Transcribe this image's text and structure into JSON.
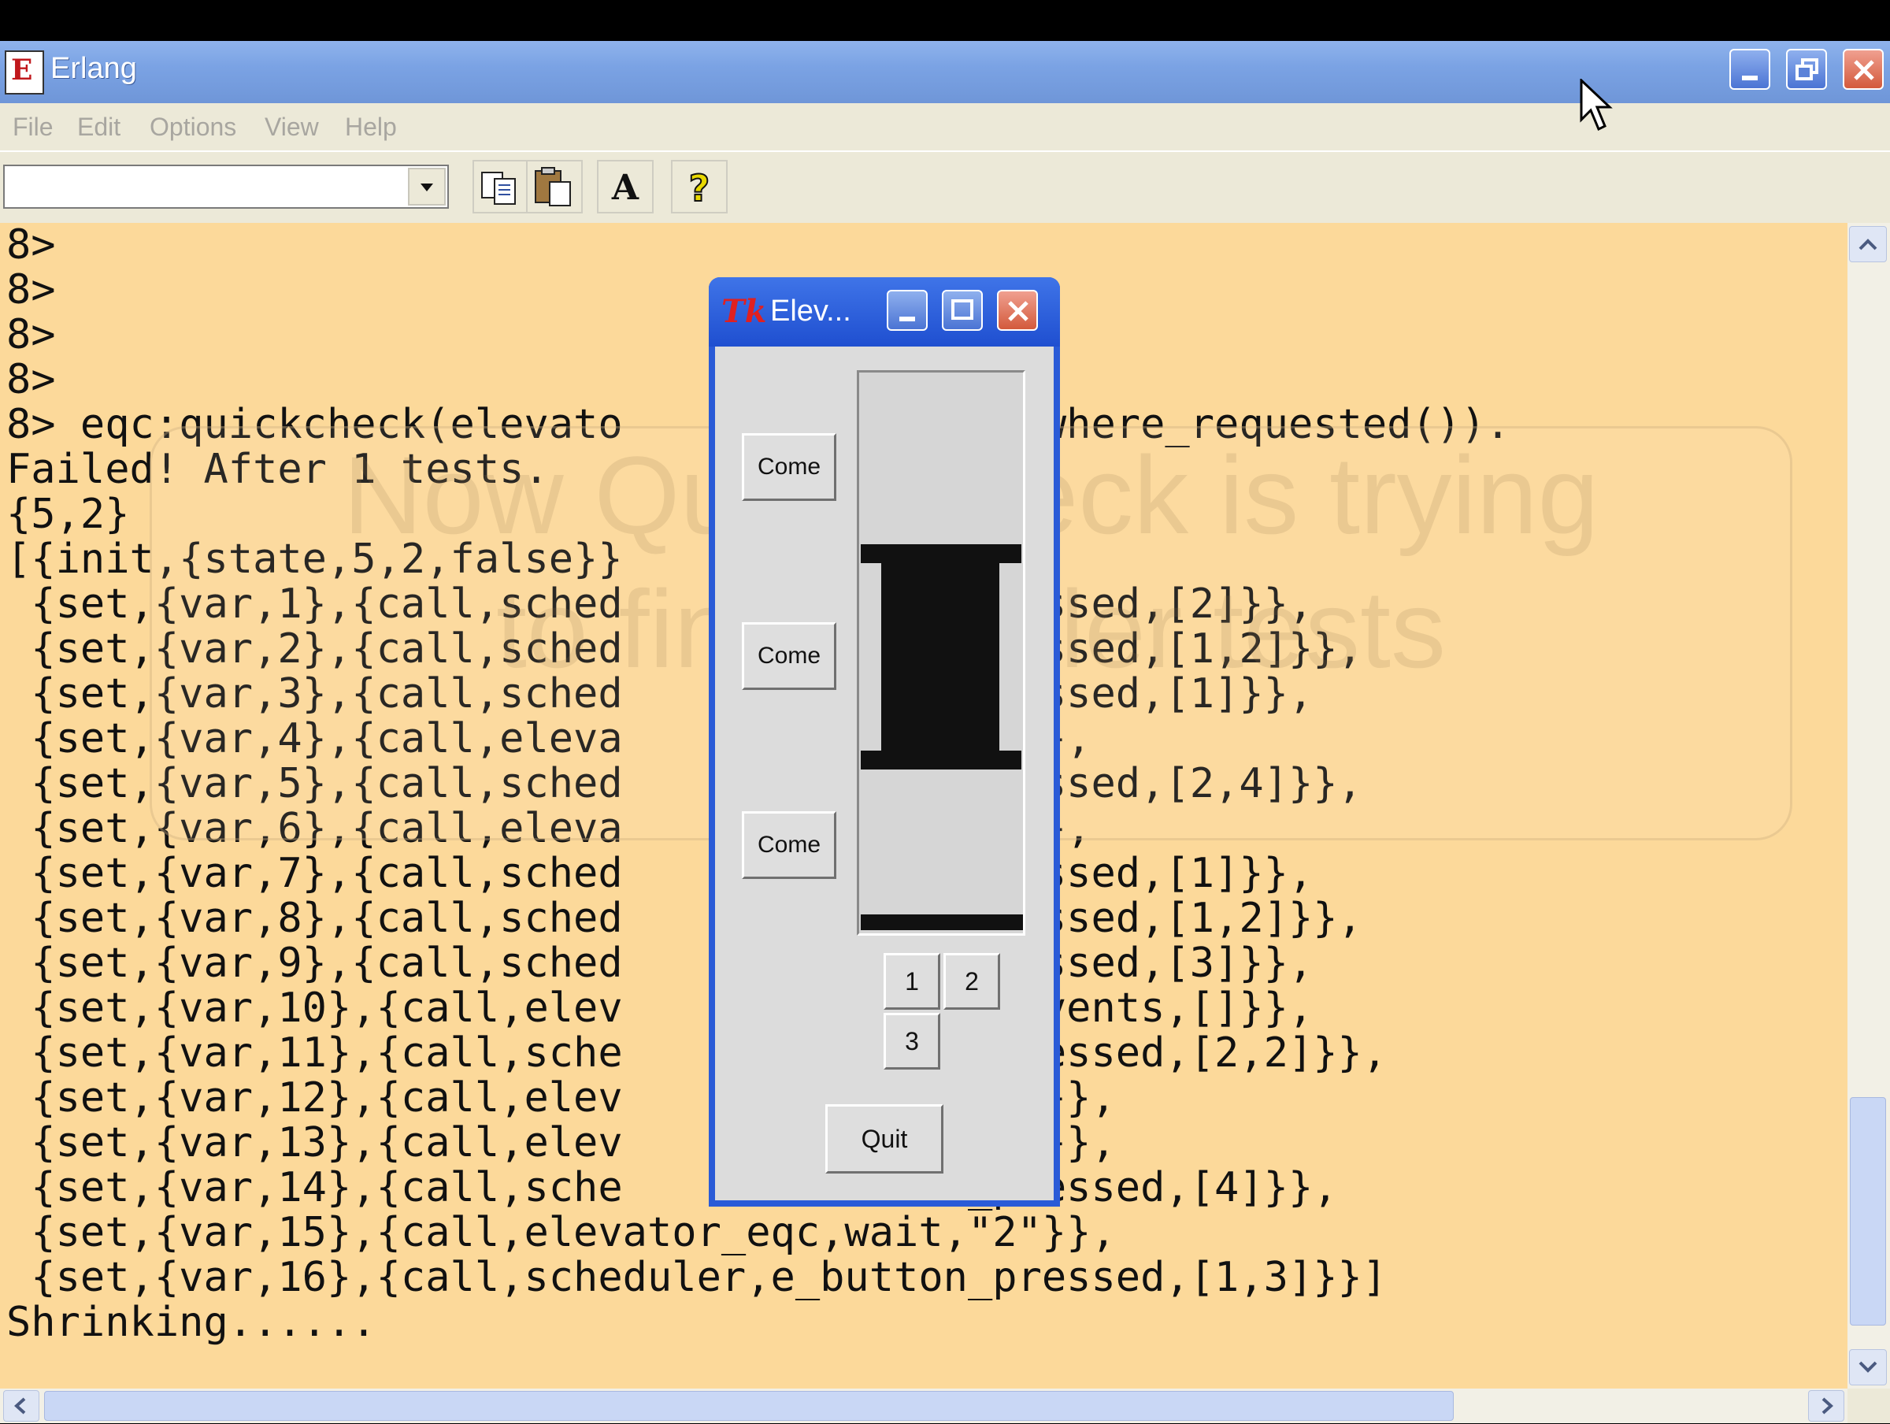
{
  "window": {
    "title": "Erlang"
  },
  "menu": [
    "File",
    "Edit",
    "Options",
    "View",
    "Help"
  ],
  "toolbar": {
    "combo_value": "",
    "buttons": [
      "copy-icon",
      "paste-icon",
      "font-icon",
      "help-icon"
    ],
    "font_glyph": "A",
    "help_glyph": "?"
  },
  "console": {
    "lines": [
      "8>",
      "8>",
      "8>",
      "8>",
      "8> eqc:quickcheck(elevato             top_where_requested()).",
      "Failed! After 1 tests.",
      "{5,2}",
      "[{init,{state,5,2,false}}",
      " {set,{var,1},{call,sched            n_pressed,[2]}},",
      " {set,{var,2},{call,sched            n_pressed,[1,2]}},",
      " {set,{var,3},{call,sched            n_pressed,[1]}},",
      " {set,{var,4},{call,eleva            ,\"2\"}},",
      " {set,{var,5},{call,sched            n_pressed,[2,4]}},",
      " {set,{var,6},{call,eleva            ,\"2\"}},",
      " {set,{var,7},{call,sched            n_pressed,[1]}},",
      " {set,{var,8},{call,sched            n_pressed,[1,2]}},",
      " {set,{var,9},{call,sched            n_pressed,[3]}},",
      " {set,{var,10},{call,elev            lectevents,[]}},",
      " {set,{var,11},{call,sche            on_pressed,[2,2]}},",
      " {set,{var,12},{call,elev            t,\"2\"}},",
      " {set,{var,13},{call,elev            t,\"2\"}},",
      " {set,{var,14},{call,sche            on_pressed,[4]}},",
      " {set,{var,15},{call,elevator_eqc,wait,\"2\"}},",
      " {set,{var,16},{call,scheduler,e_button_pressed,[1,3]}}]",
      "Shrinking......"
    ],
    "overlay": "Now QuickCheck is trying\nto find simpler tests"
  },
  "elevator": {
    "title": "Elev...",
    "tk_logo": "Tk",
    "come_labels": [
      "Come",
      "Come",
      "Come"
    ],
    "floor_buttons": [
      "1",
      "2",
      "3"
    ],
    "quit_label": "Quit"
  },
  "colors": {
    "console_bg": "#fcd99a",
    "titlebar": "#7ba3e4",
    "elev_frame": "#2a5bd7"
  }
}
